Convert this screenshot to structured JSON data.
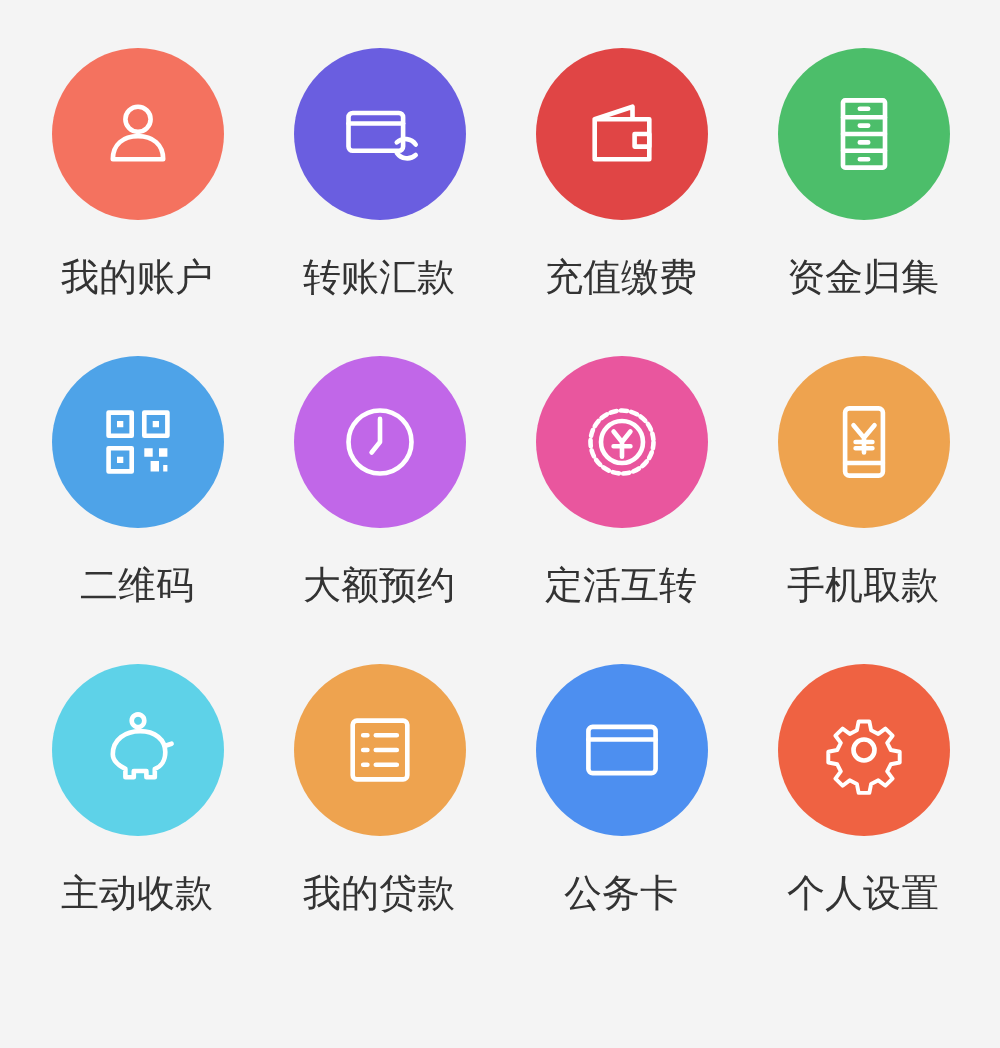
{
  "items": [
    {
      "label": "我的账户",
      "color": "#f4725f"
    },
    {
      "label": "转账汇款",
      "color": "#6a5ee0"
    },
    {
      "label": "充值缴费",
      "color": "#e04545"
    },
    {
      "label": "资金归集",
      "color": "#4cbe6a"
    },
    {
      "label": "二维码",
      "color": "#4ea3e8"
    },
    {
      "label": "大额预约",
      "color": "#c167e8"
    },
    {
      "label": "定活互转",
      "color": "#e9569e"
    },
    {
      "label": "手机取款",
      "color": "#eea34f"
    },
    {
      "label": "主动收款",
      "color": "#5ed2e8"
    },
    {
      "label": "我的贷款",
      "color": "#eea34f"
    },
    {
      "label": "公务卡",
      "color": "#4d8ff0"
    },
    {
      "label": "个人设置",
      "color": "#ef6242"
    }
  ]
}
